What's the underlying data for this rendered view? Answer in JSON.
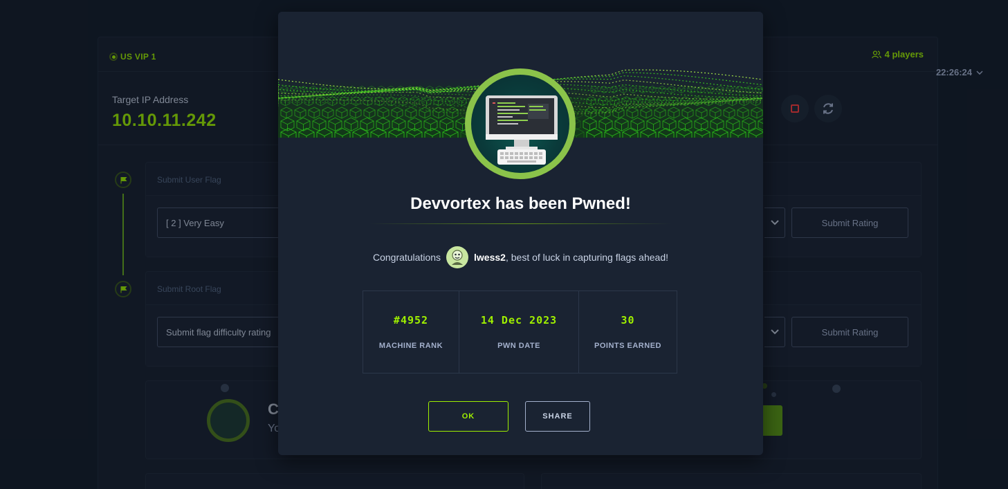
{
  "server": {
    "label": "US VIP 1",
    "players": "4 players"
  },
  "target": {
    "label": "Target IP Address",
    "ip": "10.10.11.242"
  },
  "session": {
    "timer": "22:26:24"
  },
  "user_flag": {
    "title": "Submit User Flag",
    "difficulty": "[ 2 ] Very Easy",
    "submit_label": "Submit Rating"
  },
  "root_flag": {
    "title": "Submit Root Flag",
    "difficulty_placeholder": "Submit flag difficulty rating",
    "submit_label": "Submit Rating"
  },
  "bottom_card": {
    "title_fragment": "C",
    "sub_fragment": "Yo"
  },
  "modal": {
    "title": "Devvortex has been Pwned!",
    "congrats_prefix": "Congratulations",
    "username": "lwess2",
    "congrats_suffix": ", best of luck in capturing flags ahead!",
    "stats": [
      {
        "value": "#4952",
        "label": "MACHINE RANK"
      },
      {
        "value": "14 Dec 2023",
        "label": "PWN DATE"
      },
      {
        "value": "30",
        "label": "POINTS EARNED"
      }
    ],
    "ok_label": "OK",
    "share_label": "SHARE"
  },
  "colors": {
    "accent": "#9fef00",
    "background": "#141d2b",
    "card": "#1a2332",
    "stop": "#ff3e3e"
  },
  "icons": [
    "server-status-icon",
    "players-icon",
    "stop-icon",
    "reset-icon",
    "chevron-down-icon",
    "flag-icon",
    "machine-avatar-icon",
    "user-avatar-icon"
  ]
}
